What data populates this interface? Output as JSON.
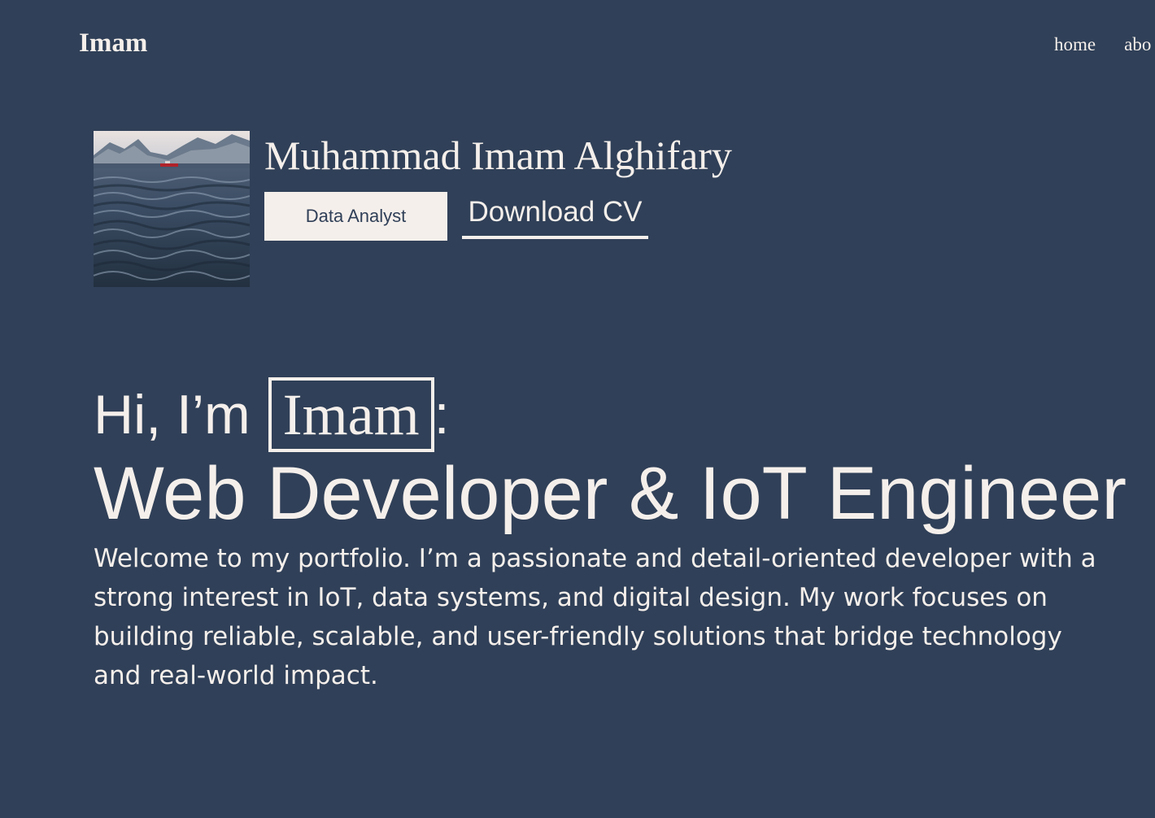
{
  "header": {
    "brand": "Imam",
    "nav": [
      {
        "label": "home"
      },
      {
        "label": "abo"
      }
    ]
  },
  "profile": {
    "full_name": "Muhammad Imam Alghifary",
    "role_button": "Data Analyst",
    "cv_link": "Download CV",
    "avatar_icon": "ocean-landscape-image"
  },
  "hero": {
    "greeting_prefix": "Hi, I’m",
    "highlight_name": "Imam",
    "greeting_suffix": ":",
    "headline": "Web Developer & IoT Engineer",
    "intro": "Welcome to my portfolio. I’m a passionate and detail-oriented developer with a strong interest in IoT, data systems, and digital design. My work focuses on building reliable, scalable, and user-friendly solutions that bridge technology and real-world impact."
  },
  "colors": {
    "background": "#304058",
    "foreground": "#f5efeb"
  }
}
